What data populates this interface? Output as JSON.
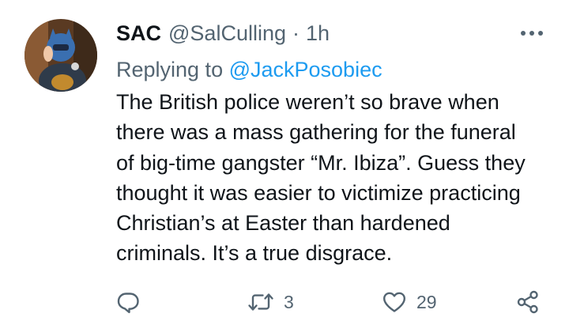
{
  "author": {
    "name": "SAC",
    "handle": "@SalCulling",
    "separator": "·",
    "time": "1h"
  },
  "reply_to": {
    "prefix": "Replying to ",
    "mention": "@JackPosobiec"
  },
  "tweet_text": "The British police weren’t so brave when\nthere was a mass gathering for the funeral\nof big-time gangster “Mr. Ibiza”. Guess they\nthought it was easier to victimize practicing\nChristian’s at Easter than hardened\ncriminals. It’s a true disgrace.",
  "actions": {
    "reply": {
      "icon": "comment-icon",
      "count": ""
    },
    "retweet": {
      "icon": "retweet-icon",
      "count": "3"
    },
    "like": {
      "icon": "heart-icon",
      "count": "29"
    },
    "share": {
      "icon": "share-icon"
    }
  },
  "colors": {
    "text": "#0f1419",
    "secondary": "#536471",
    "link": "#1d9bf0"
  }
}
